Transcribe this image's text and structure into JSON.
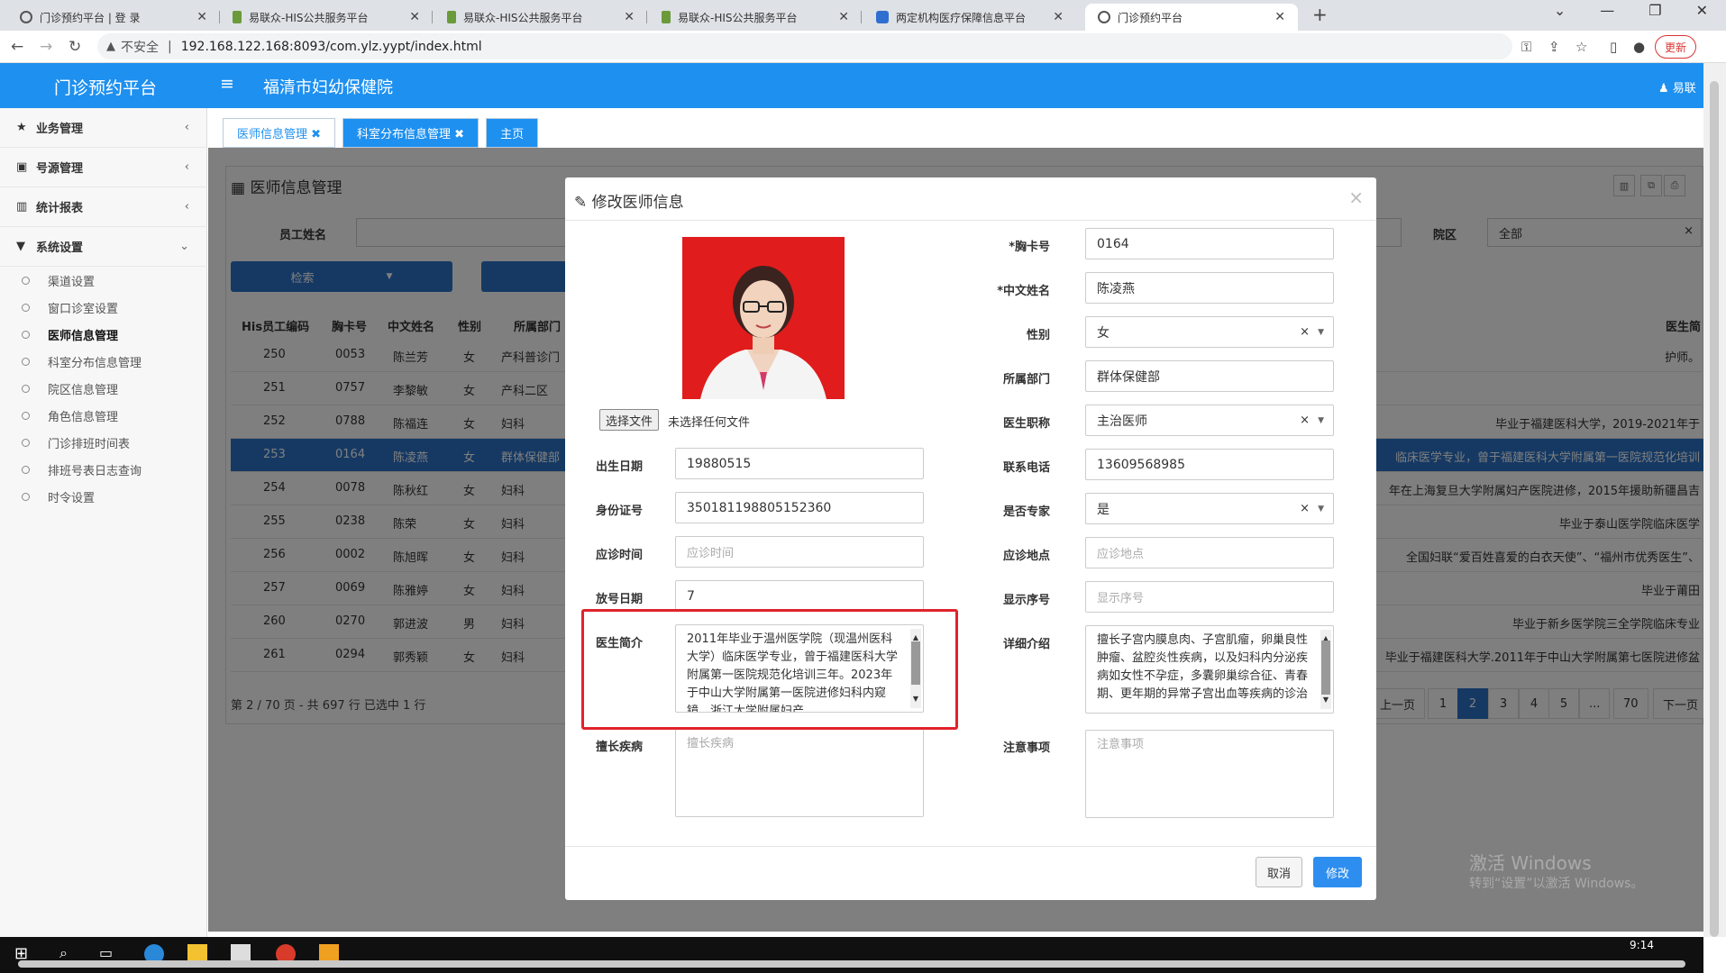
{
  "browser": {
    "tabs": [
      {
        "title": "门诊预约平台 | 登 录",
        "icon": "globe-icon"
      },
      {
        "title": "易联众-HIS公共服务平台",
        "icon": "his-icon"
      },
      {
        "title": "易联众-HIS公共服务平台",
        "icon": "his-icon"
      },
      {
        "title": "易联众-HIS公共服务平台",
        "icon": "his-icon"
      },
      {
        "title": "两定机构医疗保障信息平台",
        "icon": "cms-icon"
      },
      {
        "title": "门诊预约平台",
        "icon": "globe-icon"
      }
    ],
    "insecure_label": "不安全",
    "url": "192.168.122.168:8093/com.ylz.yypt/index.html",
    "update_label": "更新"
  },
  "app": {
    "title": "门诊预约平台",
    "hospital": "福清市妇幼保健院",
    "user": "易联"
  },
  "sidebar": {
    "groups": [
      {
        "label": "业务管理",
        "icon": "star-icon",
        "glyph": "★",
        "chev": "‹"
      },
      {
        "label": "号源管理",
        "icon": "card-icon",
        "glyph": "▣",
        "chev": "‹"
      },
      {
        "label": "统计报表",
        "icon": "bar-chart-icon",
        "glyph": "▥",
        "chev": "‹"
      },
      {
        "label": "系统设置",
        "icon": "filter-icon",
        "glyph": "▼",
        "chev": "⌄"
      }
    ],
    "items": [
      {
        "label": "渠道设置"
      },
      {
        "label": "窗口诊室设置"
      },
      {
        "label": "医师信息管理"
      },
      {
        "label": "科室分布信息管理"
      },
      {
        "label": "院区信息管理"
      },
      {
        "label": "角色信息管理"
      },
      {
        "label": "门诊排班时间表"
      },
      {
        "label": "排班号表日志查询"
      },
      {
        "label": "时令设置"
      }
    ]
  },
  "content_tabs": [
    "医师信息管理 ✖",
    "科室分布信息管理 ✖",
    "主页"
  ],
  "page": {
    "title": "医师信息管理",
    "filter_label_name": "员工姓名",
    "filter_label_area": "院区",
    "area_value": "全部",
    "search_label": "检索",
    "columns": [
      "His员工编码",
      "胸卡号",
      "中文姓名",
      "性别",
      "所属部门",
      "医生简"
    ],
    "rows": [
      [
        "250",
        "0053",
        "陈兰芳",
        "女",
        "产科普诊门",
        "护师。"
      ],
      [
        "251",
        "0757",
        "李黎敏",
        "女",
        "产科二区",
        ""
      ],
      [
        "252",
        "0788",
        "陈福连",
        "女",
        "妇科",
        "毕业于福建医科大学，2019-2021年于"
      ],
      [
        "253",
        "0164",
        "陈凌燕",
        "女",
        "群体保健部",
        "临床医学专业，曾于福建医科大学附属第一医院规范化培训"
      ],
      [
        "254",
        "0078",
        "陈秋红",
        "女",
        "妇科",
        "年在上海复旦大学附属妇产医院进修，2015年援助新疆昌吉"
      ],
      [
        "255",
        "0238",
        "陈荣",
        "女",
        "妇科",
        "毕业于泰山医学院临床医学"
      ],
      [
        "256",
        "0002",
        "陈旭晖",
        "女",
        "妇科",
        "全国妇联“爱百姓喜爱的白衣天使”、“福州市优秀医生”、"
      ],
      [
        "257",
        "0069",
        "陈雅婷",
        "女",
        "妇科",
        "毕业于莆田"
      ],
      [
        "260",
        "0270",
        "郭进波",
        "男",
        "妇科",
        "毕业于新乡医学院三全学院临床专业"
      ],
      [
        "261",
        "0294",
        "郭秀颖",
        "女",
        "妇科",
        "毕业于福建医科大学.2011年于中山大学附属第七医院进修盆"
      ]
    ],
    "pager_text": "第 2 / 70 页 - 共 697 行    已选中 1 行",
    "pager": [
      "上一页",
      "1",
      "2",
      "3",
      "4",
      "5",
      "...",
      "70",
      "下一页"
    ]
  },
  "modal": {
    "title": "修改医师信息",
    "choose_file": "选择文件",
    "no_file": "未选择任何文件",
    "left_fields": [
      {
        "label": "出生日期",
        "value": "19880515",
        "placeholder": ""
      },
      {
        "label": "身份证号",
        "value": "350181198805152360",
        "placeholder": ""
      },
      {
        "label": "应诊时间",
        "value": "",
        "placeholder": "应诊时间"
      },
      {
        "label": "放号日期",
        "value": "7",
        "placeholder": ""
      }
    ],
    "right_fields": [
      {
        "label": "*胸卡号",
        "value": "0164",
        "placeholder": ""
      },
      {
        "label": "*中文姓名",
        "value": "陈凌燕",
        "placeholder": ""
      },
      {
        "label": "性别",
        "value": "女",
        "placeholder": ""
      },
      {
        "label": "所属部门",
        "value": "群体保健部",
        "placeholder": ""
      },
      {
        "label": "医生职称",
        "value": "主治医师",
        "placeholder": ""
      },
      {
        "label": "联系电话",
        "value": "13609568985",
        "placeholder": ""
      },
      {
        "label": "是否专家",
        "value": "是",
        "placeholder": ""
      },
      {
        "label": "应诊地点",
        "value": "",
        "placeholder": "应诊地点"
      },
      {
        "label": "显示序号",
        "value": "",
        "placeholder": "显示序号"
      }
    ],
    "intro_label": "医生简介",
    "intro_value": "2011年毕业于温州医学院（现温州医科大学）临床医学专业，曾于福建医科大学附属第一医院规范化培训三年。2023年于中山大学附属第一医院进修妇科内窥镜、浙江大学附属妇产",
    "detail_label": "详细介绍",
    "detail_value": "擅长子宫内膜息肉、子宫肌瘤，卵巢良性肿瘤、盆腔炎性疾病，以及妇科内分泌疾病如女性不孕症，多囊卵巢综合征、青春期、更年期的异常子宫出血等疾病的诊治",
    "specialty_label": "擅长疾病",
    "specialty_placeholder": "擅长疾病",
    "notes_label": "注意事项",
    "notes_placeholder": "注意事项",
    "cancel": "取消",
    "submit": "修改"
  },
  "watermark": {
    "line1": "激活 Windows",
    "line2": "转到“设置”以激活 Windows。"
  },
  "taskbar": {
    "time": "9:14"
  }
}
